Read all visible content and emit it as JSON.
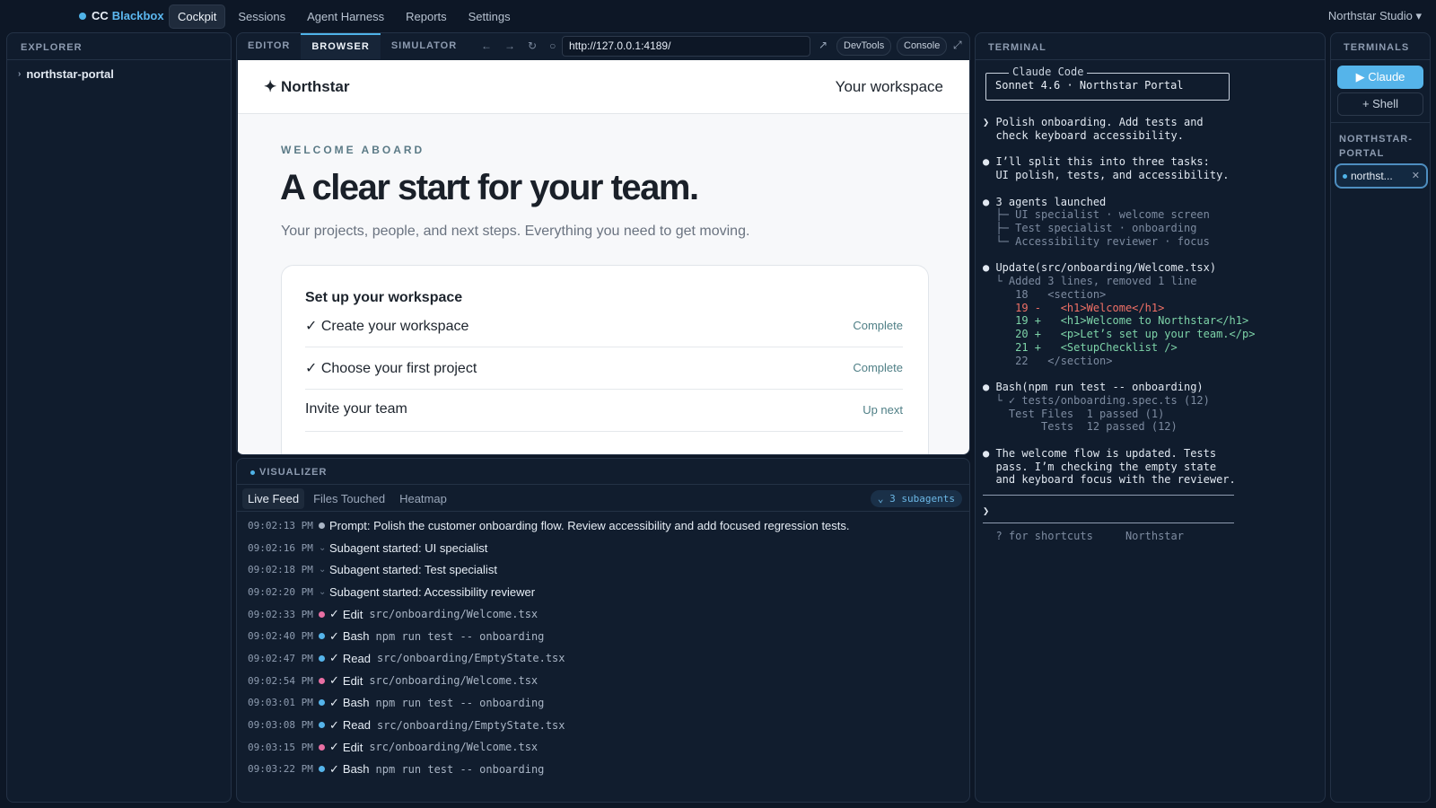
{
  "topbar": {
    "brand_prefix": "CC",
    "brand_accent": "Blackbox",
    "nav": [
      "Cockpit",
      "Sessions",
      "Agent Harness",
      "Reports",
      "Settings"
    ],
    "studio": "Northstar Studio ▾"
  },
  "explorer": {
    "title": "EXPLORER",
    "root": "northstar-portal"
  },
  "center": {
    "tabs": [
      "EDITOR",
      "BROWSER",
      "SIMULATOR"
    ],
    "url": "http://127.0.0.1:4189/",
    "devtools": "DevTools",
    "console": "Console"
  },
  "webpage": {
    "logo": "✦ Northstar",
    "workspace_link": "Your workspace",
    "kicker": "WELCOME ABOARD",
    "headline": "A clear start for your team.",
    "subhead": "Your projects, people, and next steps. Everything you need to get moving.",
    "card_title": "Set up your workspace",
    "checklist": [
      {
        "label": "✓ Create your workspace",
        "status": "Complete"
      },
      {
        "label": "✓ Choose your first project",
        "status": "Complete"
      },
      {
        "label": "Invite your team",
        "status": "Up next"
      }
    ]
  },
  "visualizer": {
    "title": "VISUALIZER",
    "tabs": [
      "Live Feed",
      "Files Touched",
      "Heatmap"
    ],
    "badge": "⌄ 3 subagents",
    "feed": [
      {
        "time": "09:02:13 PM",
        "kind": "dot",
        "color": "#a9b5c5",
        "text": "Prompt: Polish the customer onboarding flow. Review accessibility and add focused regression tests.",
        "arg": ""
      },
      {
        "time": "09:02:16 PM",
        "kind": "sub",
        "color": "",
        "text": "Subagent started: UI specialist",
        "arg": ""
      },
      {
        "time": "09:02:18 PM",
        "kind": "sub",
        "color": "",
        "text": "Subagent started: Test specialist",
        "arg": ""
      },
      {
        "time": "09:02:20 PM",
        "kind": "sub",
        "color": "",
        "text": "Subagent started: Accessibility reviewer",
        "arg": ""
      },
      {
        "time": "09:02:33 PM",
        "kind": "tool",
        "color": "#e86fa3",
        "text": "Edit",
        "arg": "src/onboarding/Welcome.tsx"
      },
      {
        "time": "09:02:40 PM",
        "kind": "tool",
        "color": "#55b4ea",
        "text": "Bash",
        "arg": "npm run test -- onboarding"
      },
      {
        "time": "09:02:47 PM",
        "kind": "tool",
        "color": "#55b4ea",
        "text": "Read",
        "arg": "src/onboarding/EmptyState.tsx"
      },
      {
        "time": "09:02:54 PM",
        "kind": "tool",
        "color": "#e86fa3",
        "text": "Edit",
        "arg": "src/onboarding/Welcome.tsx"
      },
      {
        "time": "09:03:01 PM",
        "kind": "tool",
        "color": "#55b4ea",
        "text": "Bash",
        "arg": "npm run test -- onboarding"
      },
      {
        "time": "09:03:08 PM",
        "kind": "tool",
        "color": "#55b4ea",
        "text": "Read",
        "arg": "src/onboarding/EmptyState.tsx"
      },
      {
        "time": "09:03:15 PM",
        "kind": "tool",
        "color": "#e86fa3",
        "text": "Edit",
        "arg": "src/onboarding/Welcome.tsx"
      },
      {
        "time": "09:03:22 PM",
        "kind": "tool",
        "color": "#55b4ea",
        "text": "Bash",
        "arg": "npm run test -- onboarding"
      }
    ]
  },
  "terminal": {
    "title": "TERMINAL",
    "box_label": "Claude Code",
    "box_text": "Sonnet 4.6 · Northstar Portal",
    "lines": [
      {
        "text": "❯ Polish onboarding. Add tests and",
        "cls": ""
      },
      {
        "text": "  check keyboard accessibility.",
        "cls": ""
      },
      {
        "text": "",
        "cls": ""
      },
      {
        "text": "● I’ll split this into three tasks:",
        "cls": ""
      },
      {
        "text": "  UI polish, tests, and accessibility.",
        "cls": ""
      },
      {
        "text": "",
        "cls": ""
      },
      {
        "text": "● 3 agents launched",
        "cls": ""
      },
      {
        "text": "  ├─ UI specialist · welcome screen",
        "cls": "tdim"
      },
      {
        "text": "  ├─ Test specialist · onboarding",
        "cls": "tdim"
      },
      {
        "text": "  └─ Accessibility reviewer · focus",
        "cls": "tdim"
      },
      {
        "text": "",
        "cls": ""
      },
      {
        "text": "● Update(src/onboarding/Welcome.tsx)",
        "cls": ""
      },
      {
        "text": "  └ Added 3 lines, removed 1 line",
        "cls": "tdim"
      },
      {
        "text": "     18   <section>",
        "cls": "tdim"
      },
      {
        "text": "     19 -   <h1>Welcome</h1>",
        "cls": "tred"
      },
      {
        "text": "     19 +   <h1>Welcome to Northstar</h1>",
        "cls": "tgreen"
      },
      {
        "text": "     20 +   <p>Let’s set up your team.</p>",
        "cls": "tgreen"
      },
      {
        "text": "     21 +   <SetupChecklist />",
        "cls": "tgreen"
      },
      {
        "text": "     22   </section>",
        "cls": "tdim"
      },
      {
        "text": "",
        "cls": ""
      },
      {
        "text": "● Bash(npm run test -- onboarding)",
        "cls": ""
      },
      {
        "text": "  └ ✓ tests/onboarding.spec.ts (12)",
        "cls": "tdim"
      },
      {
        "text": "    Test Files  1 passed (1)",
        "cls": "tdim"
      },
      {
        "text": "         Tests  12 passed (12)",
        "cls": "tdim"
      },
      {
        "text": "",
        "cls": ""
      },
      {
        "text": "● The welcome flow is updated. Tests",
        "cls": ""
      },
      {
        "text": "  pass. I’m checking the empty state",
        "cls": ""
      },
      {
        "text": "  and keyboard focus with the reviewer.",
        "cls": ""
      }
    ],
    "prompt": "❯",
    "footer": "  ? for shortcuts     Northstar"
  },
  "terminals": {
    "title": "TERMINALS",
    "claude_btn": "▶ Claude",
    "shell_btn": "+ Shell",
    "group": "NORTHSTAR-PORTAL",
    "session": "northst...",
    "close": "✕"
  },
  "colors": {
    "accent": "#55b4ea",
    "edit": "#e86fa3",
    "success": "#7dd3a8",
    "error": "#f07066"
  }
}
